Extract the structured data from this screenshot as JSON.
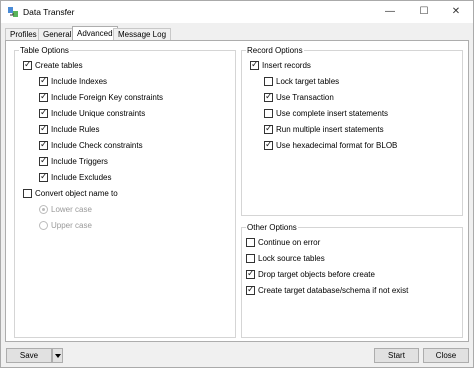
{
  "window": {
    "title": "Data Transfer",
    "controls": {
      "minimize": "—",
      "maximize": "☐",
      "close": "✕"
    }
  },
  "tabs": [
    {
      "label": "Profiles",
      "active": false
    },
    {
      "label": "General",
      "active": false
    },
    {
      "label": "Advanced",
      "active": true
    },
    {
      "label": "Message Log",
      "active": false
    }
  ],
  "table_options": {
    "title": "Table Options",
    "items": [
      {
        "label": "Create tables",
        "checked": true
      },
      {
        "label": "Include Indexes",
        "checked": true
      },
      {
        "label": "Include Foreign Key constraints",
        "checked": true
      },
      {
        "label": "Include Unique constraints",
        "checked": true
      },
      {
        "label": "Include Rules",
        "checked": true
      },
      {
        "label": "Include Check constraints",
        "checked": true
      },
      {
        "label": "Include Triggers",
        "checked": true
      },
      {
        "label": "Include Excludes",
        "checked": true
      },
      {
        "label": "Convert object name to",
        "checked": false
      },
      {
        "label": "Lower case",
        "checked": true,
        "disabled": true
      },
      {
        "label": "Upper case",
        "checked": false,
        "disabled": true
      }
    ]
  },
  "record_options": {
    "title": "Record Options",
    "items": [
      {
        "label": "Insert records",
        "checked": true
      },
      {
        "label": "Lock target tables",
        "checked": false
      },
      {
        "label": "Use Transaction",
        "checked": true
      },
      {
        "label": "Use complete insert statements",
        "checked": false
      },
      {
        "label": "Run multiple insert statements",
        "checked": true
      },
      {
        "label": "Use hexadecimal format for BLOB",
        "checked": true
      }
    ]
  },
  "other_options": {
    "title": "Other Options",
    "items": [
      {
        "label": "Continue on error",
        "checked": false
      },
      {
        "label": "Lock source tables",
        "checked": false
      },
      {
        "label": "Drop target objects before create",
        "checked": true
      },
      {
        "label": "Create target database/schema if not exist",
        "checked": true
      }
    ]
  },
  "buttons": {
    "save": "Save",
    "start": "Start",
    "close": "Close"
  },
  "colors": {
    "window_bg": "#f0f0f0",
    "panel_bg": "#ffffff",
    "button_bg": "#e1e1e1",
    "border": "#adadad",
    "disabled_text": "#9a9a9a"
  }
}
